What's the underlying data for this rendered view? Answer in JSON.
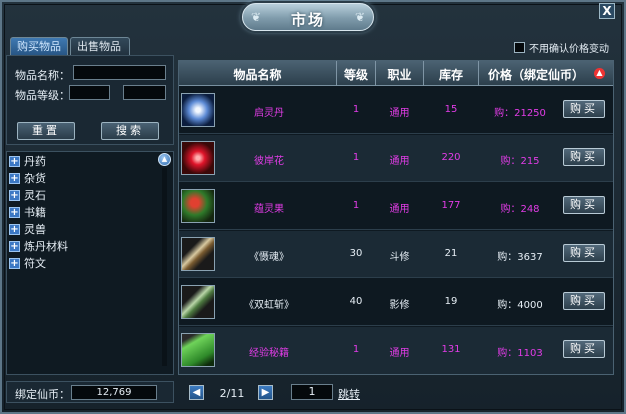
{
  "window": {
    "title": "市场",
    "close_label": "X"
  },
  "tabs": [
    {
      "label": "购买物品",
      "active": true
    },
    {
      "label": "出售物品",
      "active": false
    }
  ],
  "search": {
    "name_label": "物品名称：",
    "name_value": "",
    "level_label": "物品等级：",
    "level_min": "",
    "level_max": "",
    "reset_label": "重置",
    "search_label": "搜索"
  },
  "categories": [
    "丹药",
    "杂货",
    "灵石",
    "书籍",
    "灵兽",
    "炼丹材料",
    "符文"
  ],
  "options": {
    "no_confirm_label": "不用确认价格变动",
    "no_confirm_checked": false
  },
  "table": {
    "headers": {
      "name": "物品名称",
      "level": "等级",
      "job": "职业",
      "stock": "库存",
      "price": "价格（绑定仙币）"
    },
    "buy_label": "购买",
    "rows": [
      {
        "name": "启灵丹",
        "level": "1",
        "job": "通用",
        "stock": "15",
        "price": "购：21250",
        "color": "purple",
        "icon": "swirl-orb-icon"
      },
      {
        "name": "彼岸花",
        "level": "1",
        "job": "通用",
        "stock": "220",
        "price": "购：215",
        "color": "purple",
        "icon": "red-flower-icon"
      },
      {
        "name": "蕴灵果",
        "level": "1",
        "job": "通用",
        "stock": "177",
        "price": "购：248",
        "color": "purple",
        "icon": "berry-branch-icon"
      },
      {
        "name": "《慑魂》",
        "level": "30",
        "job": "斗修",
        "stock": "21",
        "price": "购：3637",
        "color": "white",
        "icon": "scroll-icon"
      },
      {
        "name": "《双虹斩》",
        "level": "40",
        "job": "影修",
        "stock": "19",
        "price": "购：4000",
        "color": "white",
        "icon": "scroll-icon"
      },
      {
        "name": "经验秘籍",
        "level": "1",
        "job": "通用",
        "stock": "131",
        "price": "购：1103",
        "color": "purple",
        "icon": "green-book-icon"
      }
    ]
  },
  "currency": {
    "label": "绑定仙币：",
    "value": "12,769"
  },
  "pager": {
    "page": "2/11",
    "goto_value": "1",
    "goto_label": "跳转"
  }
}
